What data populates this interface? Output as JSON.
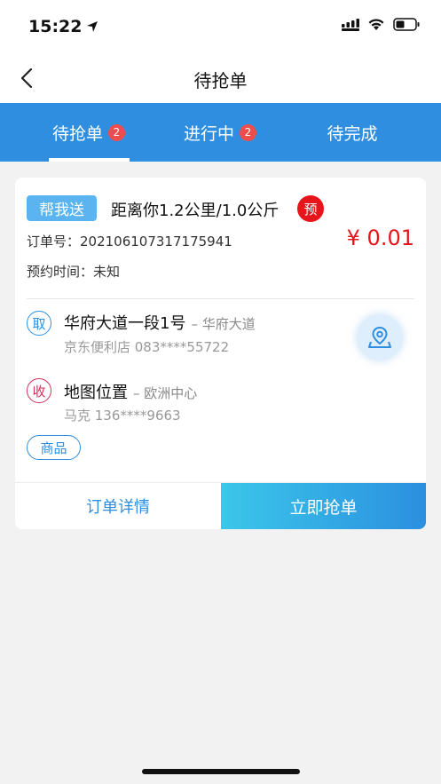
{
  "status_bar": {
    "time": "15:22"
  },
  "nav": {
    "title": "待抢单"
  },
  "tabs": [
    {
      "label": "待抢单",
      "badge": "2",
      "active": true
    },
    {
      "label": "进行中",
      "badge": "2",
      "active": false
    },
    {
      "label": "待完成",
      "badge": "",
      "active": false
    }
  ],
  "order": {
    "tag": "帮我送",
    "distance": "距离你1.2公里/1.0公斤",
    "pre_badge": "预",
    "order_no": "订单号：2021061073171759​41",
    "price": "¥ 0.01",
    "appointment": "预约时间：未知",
    "pickup": {
      "marker": "取",
      "address": "华府大道一段1号",
      "area": "– 华府大道",
      "contact": "京东便利店 083****55722"
    },
    "receive": {
      "marker": "收",
      "address": "地图位置",
      "area": "– 欧洲中心",
      "contact": "马克 136****9663"
    },
    "goods_tag": "商品",
    "detail_button": "订单详情",
    "grab_button": "立即抢单"
  },
  "colors": {
    "primary": "#2f8ee0",
    "price_red": "#e8141b",
    "tag_blue": "#5bb4f0"
  }
}
